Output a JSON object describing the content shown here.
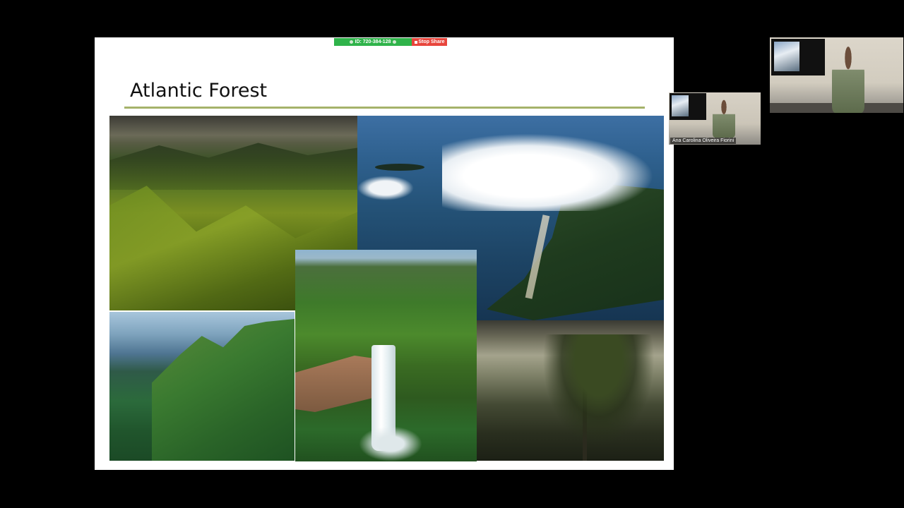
{
  "meeting": {
    "id_label": "ID: 720-384-128",
    "stop_share_label": "Stop Share",
    "accent_green": "#2fb34a",
    "accent_red": "#e8453c"
  },
  "slide": {
    "title": "Atlantic Forest",
    "rule_color": "#a5b26a",
    "photos": [
      {
        "name": "forested-mountains-photo"
      },
      {
        "name": "coastal-aerial-photo"
      },
      {
        "name": "green-peaks-photo"
      },
      {
        "name": "waterfall-canyon-photo"
      },
      {
        "name": "misty-tree-photo"
      }
    ]
  },
  "participants": [
    {
      "role": "active-speaker-video"
    },
    {
      "role": "self-view-video",
      "name": "Ana Carolina Oliveira Fiorini"
    }
  ]
}
